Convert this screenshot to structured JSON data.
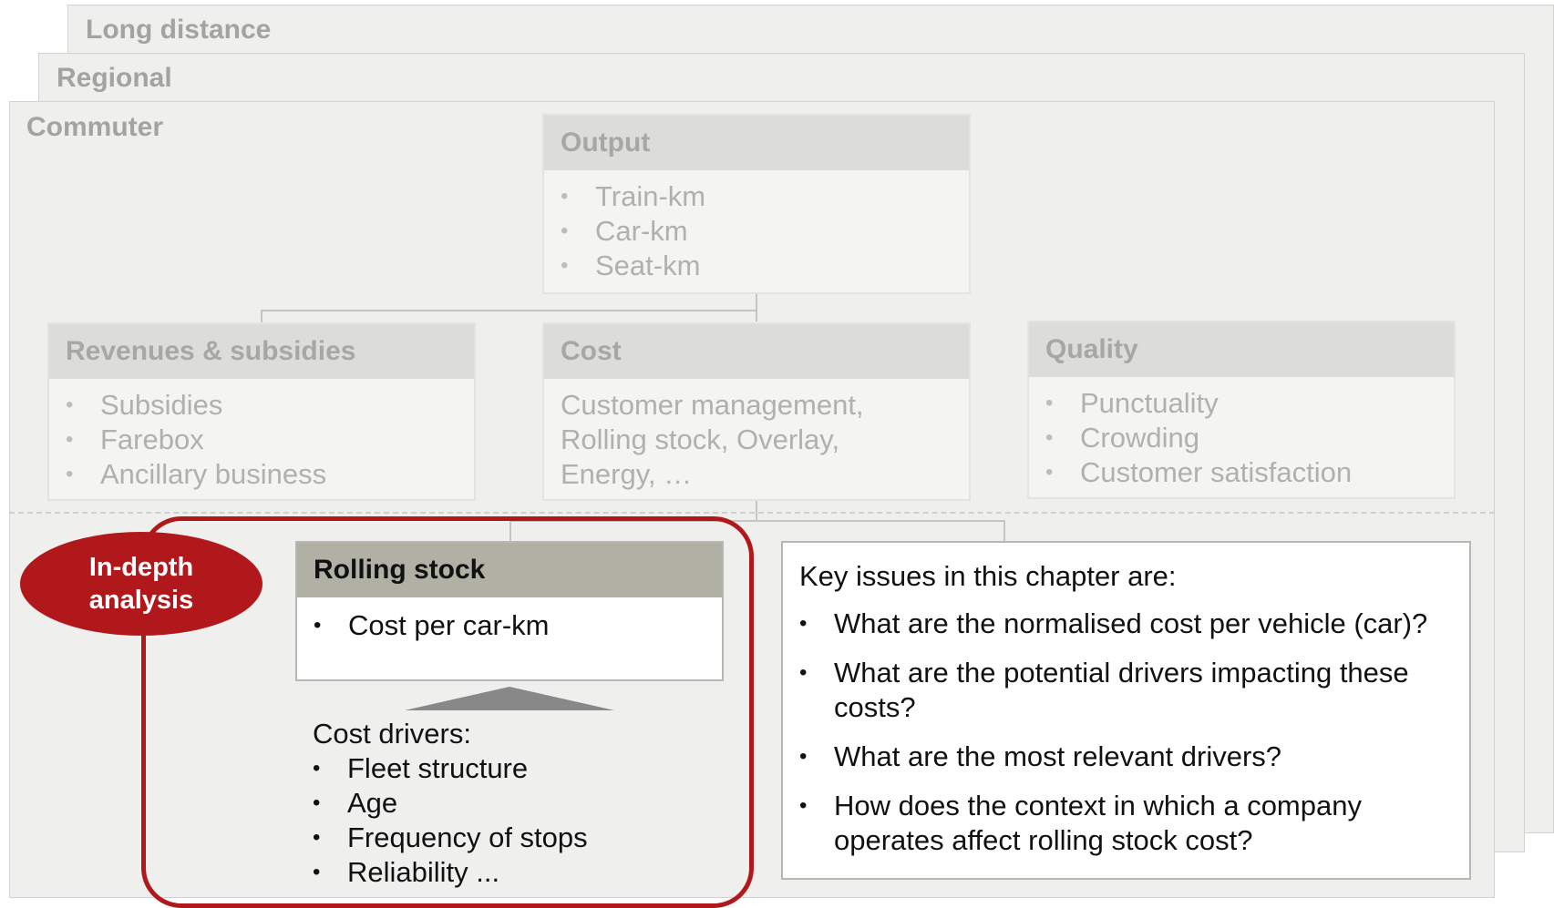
{
  "layers": {
    "long_distance": "Long distance",
    "regional": "Regional",
    "commuter": "Commuter"
  },
  "output": {
    "title": "Output",
    "items": [
      "Train-km",
      "Car-km",
      "Seat-km"
    ]
  },
  "revenues": {
    "title": "Revenues & subsidies",
    "items": [
      "Subsidies",
      "Farebox",
      "Ancillary business"
    ]
  },
  "cost": {
    "title": "Cost",
    "lines": [
      "Customer management,",
      "Rolling stock, Overlay,",
      "Energy, …"
    ]
  },
  "quality": {
    "title": "Quality",
    "items": [
      "Punctuality",
      "Crowding",
      "Customer satisfaction"
    ]
  },
  "badge": {
    "line1": "In-depth",
    "line2": "analysis"
  },
  "rolling_stock": {
    "title": "Rolling stock",
    "items": [
      "Cost per car-km"
    ]
  },
  "drivers": {
    "heading": "Cost drivers:",
    "items": [
      "Fleet structure",
      "Age",
      "Frequency of stops",
      "Reliability ..."
    ]
  },
  "key_issues": {
    "heading": "Key issues in this chapter are:",
    "items": [
      "What are the normalised cost per vehicle (car)?",
      "What are the potential drivers impacting these costs?",
      "What are the most relevant drivers?",
      "How does the context in which a company operates affect rolling stock cost?"
    ]
  },
  "colors": {
    "accent": "#b1181c",
    "layer_bg": "#efefee",
    "header_active": "#b0b0a4"
  }
}
